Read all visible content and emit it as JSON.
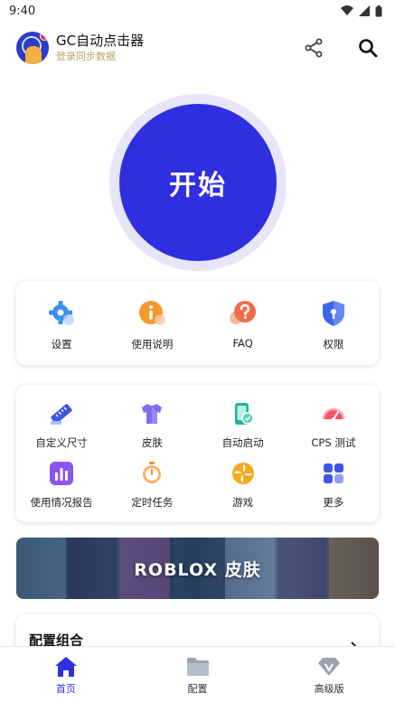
{
  "status_bar": {
    "time": "9:40"
  },
  "header": {
    "title": "GC自动点击器",
    "subtitle": "登录同步数据",
    "share_icon": "share-icon",
    "search_icon": "search-icon"
  },
  "start": {
    "label": "开始",
    "color": "#2f2fe0",
    "ring_color": "#e6e6f8"
  },
  "quick_actions": [
    {
      "label": "设置",
      "icon": "gear-icon"
    },
    {
      "label": "使用说明",
      "icon": "info-icon"
    },
    {
      "label": "FAQ",
      "icon": "question-icon"
    },
    {
      "label": "权限",
      "icon": "shield-icon"
    }
  ],
  "tools": [
    {
      "label": "自定义尺寸",
      "icon": "ruler-icon"
    },
    {
      "label": "皮肤",
      "icon": "shirt-icon"
    },
    {
      "label": "自动启动",
      "icon": "phone-auto-icon"
    },
    {
      "label": "CPS 测试",
      "icon": "speedometer-icon"
    },
    {
      "label": "使用情况报告",
      "icon": "bar-chart-icon"
    },
    {
      "label": "定时任务",
      "icon": "stopwatch-icon"
    },
    {
      "label": "游戏",
      "icon": "pinwheel-icon"
    },
    {
      "label": "更多",
      "icon": "grid-icon"
    }
  ],
  "banner": {
    "title": "ROBLOX 皮肤"
  },
  "config_section": {
    "title": "配置组合"
  },
  "bottom_nav": [
    {
      "label": "首页",
      "icon": "home-icon",
      "active": true
    },
    {
      "label": "配置",
      "icon": "folder-icon",
      "active": false
    },
    {
      "label": "高级版",
      "icon": "diamond-icon",
      "active": false
    }
  ],
  "colors": {
    "accent": "#2f2fe0",
    "subtitle": "#b9a36b"
  }
}
